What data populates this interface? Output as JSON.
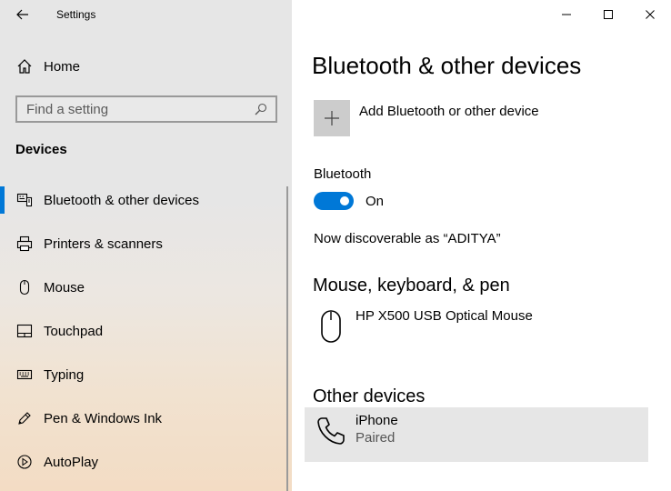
{
  "app": {
    "title": "Settings"
  },
  "sidebar": {
    "home_label": "Home",
    "search_placeholder": "Find a setting",
    "section_heading": "Devices",
    "items": [
      {
        "label": "Bluetooth & other devices",
        "icon": "bluetooth-devices-icon",
        "selected": true
      },
      {
        "label": "Printers & scanners",
        "icon": "printer-icon",
        "selected": false
      },
      {
        "label": "Mouse",
        "icon": "mouse-icon",
        "selected": false
      },
      {
        "label": "Touchpad",
        "icon": "touchpad-icon",
        "selected": false
      },
      {
        "label": "Typing",
        "icon": "keyboard-icon",
        "selected": false
      },
      {
        "label": "Pen & Windows Ink",
        "icon": "pen-icon",
        "selected": false
      },
      {
        "label": "AutoPlay",
        "icon": "autoplay-icon",
        "selected": false
      }
    ]
  },
  "main": {
    "title": "Bluetooth & other devices",
    "add_device_label": "Add Bluetooth or other device",
    "bluetooth_label": "Bluetooth",
    "bluetooth_state": "On",
    "discoverable_text": "Now discoverable as “ADITYA”",
    "mouse_section": {
      "heading": "Mouse, keyboard, & pen",
      "devices": [
        {
          "name": "HP X500 USB Optical Mouse",
          "icon": "mouse-icon"
        }
      ]
    },
    "other_section": {
      "heading": "Other devices",
      "devices": [
        {
          "name": "iPhone",
          "status": "Paired",
          "icon": "phone-icon"
        }
      ]
    }
  },
  "colors": {
    "accent": "#0078d7",
    "tile": "#cccccc",
    "selected_row": "#e6e6e6"
  }
}
